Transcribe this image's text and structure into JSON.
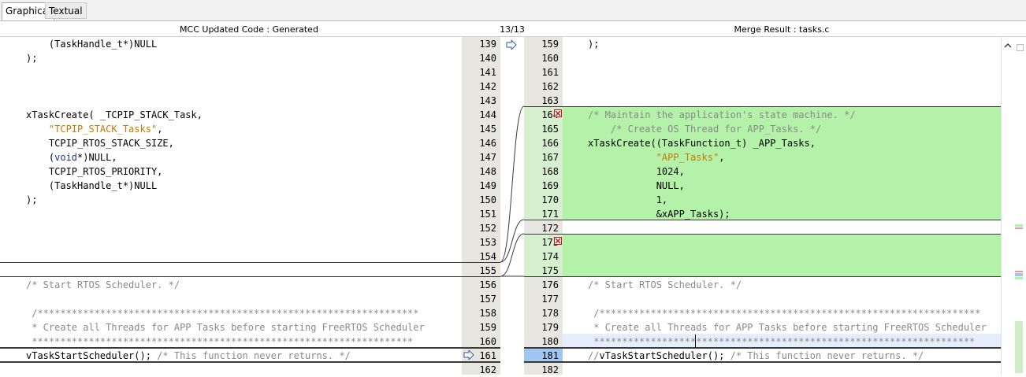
{
  "tabs": {
    "graphical": "Graphical",
    "textual": "Textual"
  },
  "header": {
    "left": "MCC Updated Code : Generated",
    "counter": "13/13",
    "right": "Merge Result : tasks.c"
  },
  "left_lines": [
    {
      "n": "139",
      "t": "    (TaskHandle_t*)NULL"
    },
    {
      "n": "140",
      "t": ");"
    },
    {
      "n": "141",
      "t": ""
    },
    {
      "n": "142",
      "t": ""
    },
    {
      "n": "143",
      "t": ""
    },
    {
      "n": "144",
      "t": "xTaskCreate( _TCPIP_STACK_Task,"
    },
    {
      "n": "145",
      "t": "    \"TCPIP_STACK_Tasks\","
    },
    {
      "n": "146",
      "t": "    TCPIP_RTOS_STACK_SIZE,"
    },
    {
      "n": "147",
      "t": "    (void*)NULL,"
    },
    {
      "n": "148",
      "t": "    TCPIP_RTOS_PRIORITY,"
    },
    {
      "n": "149",
      "t": "    (TaskHandle_t*)NULL"
    },
    {
      "n": "150",
      "t": ");"
    },
    {
      "n": "151",
      "t": ""
    },
    {
      "n": "152",
      "t": ""
    },
    {
      "n": "153",
      "t": ""
    },
    {
      "n": "154",
      "t": ""
    },
    {
      "n": "155",
      "t": ""
    },
    {
      "n": "156",
      "t": "/* Start RTOS Scheduler. */"
    },
    {
      "n": "157",
      "t": ""
    },
    {
      "n": "158",
      "t": " /*******************************************************************"
    },
    {
      "n": "159",
      "t": " * Create all Threads for APP Tasks before starting FreeRTOS Scheduler"
    },
    {
      "n": "160",
      "t": " *******************************************************************"
    },
    {
      "n": "161",
      "t": "vTaskStartScheduler(); /* This function never returns. */"
    },
    {
      "n": "162",
      "t": ""
    }
  ],
  "right_lines": [
    {
      "n": "159",
      "t": ");"
    },
    {
      "n": "160",
      "t": ""
    },
    {
      "n": "161",
      "t": ""
    },
    {
      "n": "162",
      "t": ""
    },
    {
      "n": "163",
      "t": ""
    },
    {
      "n": "164",
      "t": "/* Maintain the application's state machine. */"
    },
    {
      "n": "165",
      "t": "    /* Create OS Thread for APP_Tasks. */"
    },
    {
      "n": "166",
      "t": "xTaskCreate((TaskFunction_t) _APP_Tasks,"
    },
    {
      "n": "167",
      "t": "            \"APP_Tasks\","
    },
    {
      "n": "168",
      "t": "            1024,"
    },
    {
      "n": "169",
      "t": "            NULL,"
    },
    {
      "n": "170",
      "t": "            1,"
    },
    {
      "n": "171",
      "t": "            &xAPP_Tasks);"
    },
    {
      "n": "172",
      "t": ""
    },
    {
      "n": "173",
      "t": ""
    },
    {
      "n": "174",
      "t": ""
    },
    {
      "n": "175",
      "t": ""
    },
    {
      "n": "176",
      "t": "/* Start RTOS Scheduler. */"
    },
    {
      "n": "177",
      "t": ""
    },
    {
      "n": "178",
      "t": " /*******************************************************************"
    },
    {
      "n": "179",
      "t": " * Create all Threads for APP Tasks before starting FreeRTOS Scheduler"
    },
    {
      "n": "180",
      "t": " *******************************************************************"
    },
    {
      "n": "181",
      "t": "//vTaskStartScheduler(); /* This function never returns. */"
    },
    {
      "n": "182",
      "t": ""
    }
  ],
  "icons": {
    "conflict": "conflict-x-icon",
    "navigate": "merge-arrow-icon",
    "scroll_up": "chevron-up-icon"
  },
  "colors": {
    "added": "#b3f2a8",
    "gutter": "#e8e6e0",
    "selected": "#9fc7f2"
  }
}
